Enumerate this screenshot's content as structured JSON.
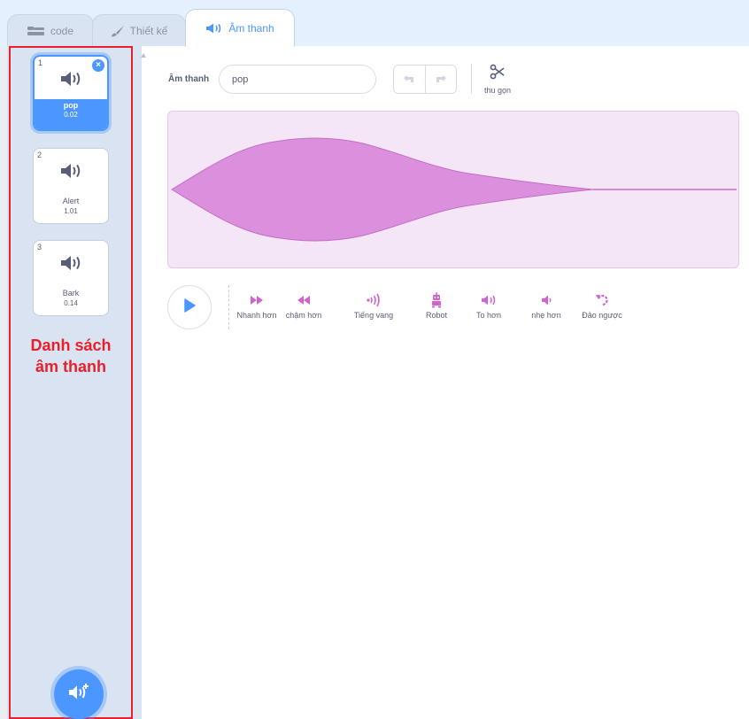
{
  "tabs": [
    {
      "label": "code",
      "icon": "code-blocks-icon"
    },
    {
      "label": "Thiết kế",
      "icon": "paintbrush-icon"
    },
    {
      "label": "Âm thanh",
      "icon": "speaker-icon",
      "active": true
    }
  ],
  "sound_list": {
    "items": [
      {
        "index": "1",
        "name": "pop",
        "duration": "0.02",
        "selected": true
      },
      {
        "index": "2",
        "name": "Alert",
        "duration": "1.01"
      },
      {
        "index": "3",
        "name": "Bark",
        "duration": "0.14"
      }
    ],
    "annotation": "Danh sách\nâm thanh",
    "add_button_icon": "add-sound-icon"
  },
  "editor": {
    "sound_label": "Âm thanh",
    "sound_name": "pop",
    "trim_label": "thu gọn",
    "effects": [
      {
        "label": "Nhanh hơn",
        "icon": "faster-icon"
      },
      {
        "label": "chậm hơn",
        "icon": "slower-icon"
      },
      {
        "label": "Tiếng vang",
        "icon": "echo-icon"
      },
      {
        "label": "Robot",
        "icon": "robot-icon"
      },
      {
        "label": "To hơn",
        "icon": "louder-icon"
      },
      {
        "label": "nhẹ hơn",
        "icon": "softer-icon"
      },
      {
        "label": "Đảo ngược",
        "icon": "reverse-icon"
      }
    ]
  },
  "colors": {
    "accent": "#4c97ff",
    "sound_purple": "#cf63cf",
    "annotation_red": "#e8202a"
  }
}
